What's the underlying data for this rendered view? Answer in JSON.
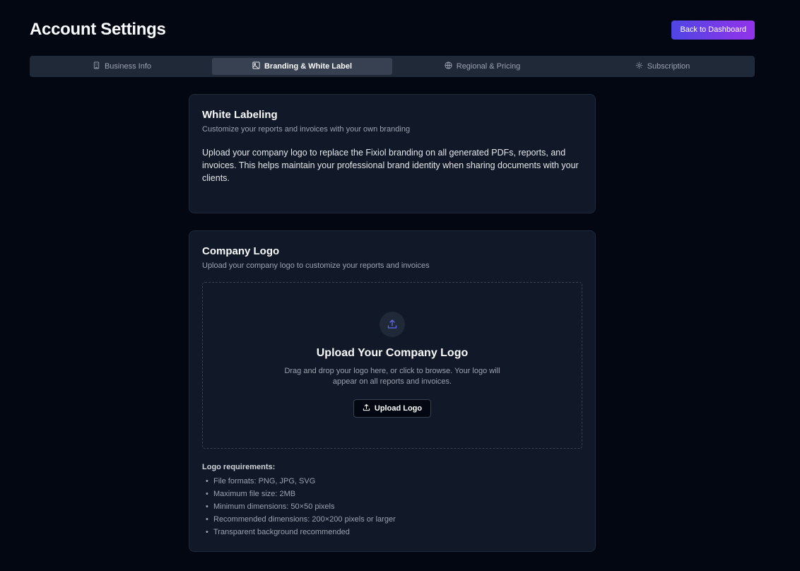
{
  "header": {
    "title": "Account Settings",
    "back_label": "Back to Dashboard"
  },
  "tabs": [
    {
      "label": "Business Info",
      "icon": "building-icon",
      "active": false
    },
    {
      "label": "Branding & White Label",
      "icon": "image-icon",
      "active": true
    },
    {
      "label": "Regional & Pricing",
      "icon": "globe-icon",
      "active": false
    },
    {
      "label": "Subscription",
      "icon": "gear-icon",
      "active": false
    }
  ],
  "white_label": {
    "title": "White Labeling",
    "subtitle": "Customize your reports and invoices with your own branding",
    "body": "Upload your company logo to replace the Fixiol branding on all generated PDFs, reports, and invoices. This helps maintain your professional brand identity when sharing documents with your clients."
  },
  "company_logo": {
    "title": "Company Logo",
    "subtitle": "Upload your company logo to customize your reports and invoices",
    "drop_title": "Upload Your Company Logo",
    "drop_desc": "Drag and drop your logo here, or click to browse. Your logo will appear on all reports and invoices.",
    "upload_label": "Upload Logo",
    "requirements_title": "Logo requirements:",
    "requirements": [
      "File formats: PNG, JPG, SVG",
      "Maximum file size: 2MB",
      "Minimum dimensions: 50×50 pixels",
      "Recommended dimensions: 200×200 pixels or larger",
      "Transparent background recommended"
    ]
  },
  "colors": {
    "background": "#030712",
    "card": "#111827",
    "accent_start": "#4f46e5",
    "accent_end": "#9333ea"
  }
}
